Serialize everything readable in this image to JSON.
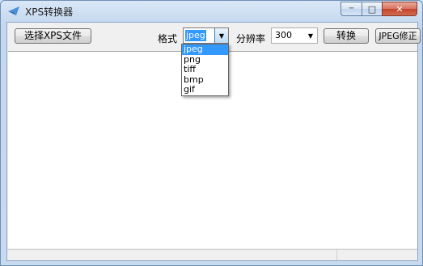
{
  "window": {
    "title": "XPS转换器",
    "buttons": {
      "minimize": "─",
      "maximize": "□",
      "close": "✕"
    }
  },
  "toolbar": {
    "select_xps_label": "选择XPS文件",
    "format_label": "格式",
    "format_value": "jpeg",
    "resolution_label": "分辨率",
    "resolution_value": "300",
    "convert_label": "转换",
    "jpeg_fix_label": "JPEG修正"
  },
  "format_dropdown": {
    "options": [
      "jpeg",
      "png",
      "tiff",
      "bmp",
      "gif"
    ],
    "selected_index": 0
  },
  "icons": {
    "app": "app-icon",
    "combo_arrow": "▼"
  },
  "colors": {
    "selection": "#3399ff",
    "close_button": "#c3442b"
  }
}
